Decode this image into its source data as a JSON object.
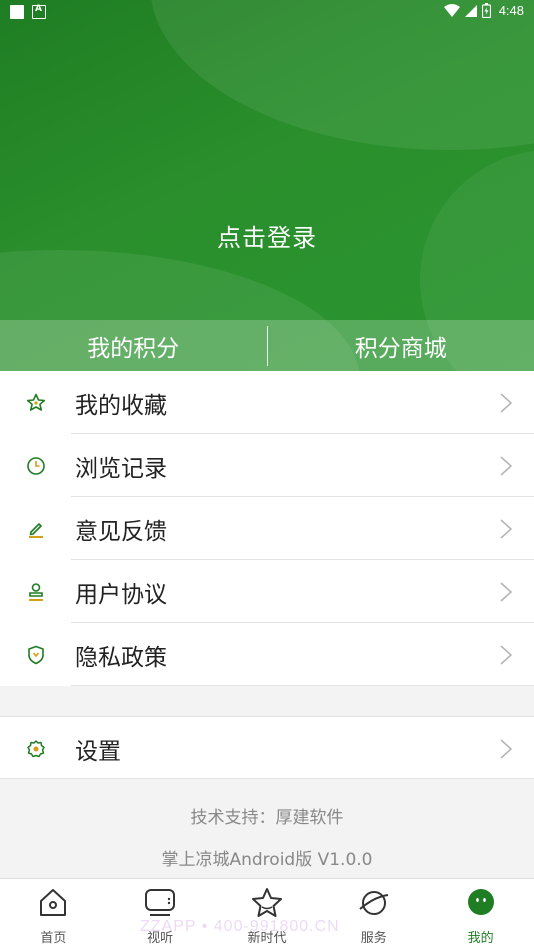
{
  "status_bar": {
    "time": "4:48"
  },
  "header": {
    "login_label": "点击登录",
    "points": {
      "my_points": "我的积分",
      "points_mall": "积分商城"
    }
  },
  "menu": [
    {
      "label": "我的收藏",
      "icon": "star-icon"
    },
    {
      "label": "浏览记录",
      "icon": "clock-icon"
    },
    {
      "label": "意见反馈",
      "icon": "edit-icon"
    },
    {
      "label": "用户协议",
      "icon": "stamp-icon"
    },
    {
      "label": "隐私政策",
      "icon": "shield-icon"
    }
  ],
  "settings": {
    "label": "设置",
    "icon": "gear-icon"
  },
  "footer": {
    "support": "技术支持：厚建软件",
    "version": "掌上凉城Android版 V1.0.0"
  },
  "tabs": [
    {
      "label": "首页",
      "icon": "home-icon"
    },
    {
      "label": "视听",
      "icon": "tv-icon"
    },
    {
      "label": "新时代",
      "icon": "star-outline-icon"
    },
    {
      "label": "服务",
      "icon": "planet-icon"
    },
    {
      "label": "我的",
      "icon": "avatar-icon",
      "active": true
    }
  ],
  "watermark": "ZZAPP • 400-991800.CN",
  "colors": {
    "brand_green": "#1f7d23",
    "icon_yellow": "#d4a017"
  }
}
